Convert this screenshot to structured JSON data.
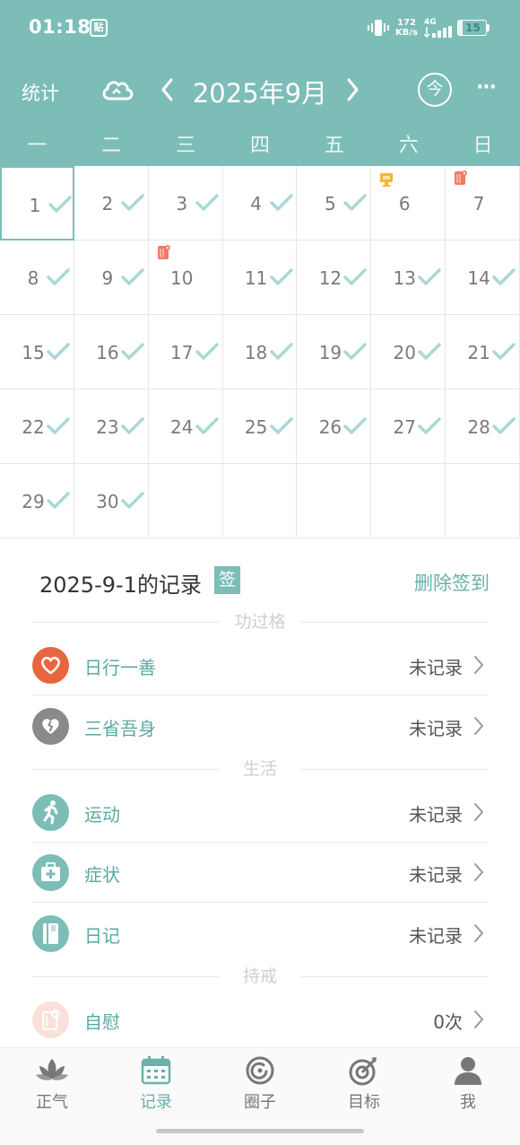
{
  "status_bar": {
    "time": "01:18",
    "badge": "贴",
    "speed_value": "172",
    "speed_unit": "KB/s",
    "network": "4G",
    "battery": "15",
    "battery_level": 0.15
  },
  "nav": {
    "stats_label": "统计",
    "month_title": "2025年9月",
    "today_label": "今",
    "more_label": "···"
  },
  "weekdays": [
    "一",
    "二",
    "三",
    "四",
    "五",
    "六",
    "日"
  ],
  "calendar": {
    "days": [
      {
        "num": "1",
        "checked": true,
        "selected": true
      },
      {
        "num": "2",
        "checked": true
      },
      {
        "num": "3",
        "checked": true
      },
      {
        "num": "4",
        "checked": true
      },
      {
        "num": "5",
        "checked": true
      },
      {
        "num": "6",
        "checked": false,
        "mark": "gift-icon"
      },
      {
        "num": "7",
        "checked": false,
        "mark": "toilet-paper-icon"
      },
      {
        "num": "8",
        "checked": true
      },
      {
        "num": "9",
        "checked": true
      },
      {
        "num": "10",
        "checked": false,
        "mark": "toilet-paper-icon"
      },
      {
        "num": "11",
        "checked": true
      },
      {
        "num": "12",
        "checked": true
      },
      {
        "num": "13",
        "checked": true
      },
      {
        "num": "14",
        "checked": true
      },
      {
        "num": "15",
        "checked": true
      },
      {
        "num": "16",
        "checked": true
      },
      {
        "num": "17",
        "checked": true
      },
      {
        "num": "18",
        "checked": true
      },
      {
        "num": "19",
        "checked": true
      },
      {
        "num": "20",
        "checked": true
      },
      {
        "num": "21",
        "checked": true
      },
      {
        "num": "22",
        "checked": true
      },
      {
        "num": "23",
        "checked": true
      },
      {
        "num": "24",
        "checked": true
      },
      {
        "num": "25",
        "checked": true
      },
      {
        "num": "26",
        "checked": true
      },
      {
        "num": "27",
        "checked": true
      },
      {
        "num": "28",
        "checked": true
      },
      {
        "num": "29",
        "checked": true
      },
      {
        "num": "30",
        "checked": true
      }
    ]
  },
  "records": {
    "title": "2025-9-1的记录",
    "sign_badge": "签",
    "delete_label": "删除签到",
    "sections": [
      {
        "title": "功过格",
        "rows": [
          {
            "label": "日行一善",
            "value": "未记录",
            "icon": "heart-icon",
            "color": "#e8663f"
          },
          {
            "label": "三省吾身",
            "value": "未记录",
            "icon": "broken-heart-icon",
            "color": "#8a8a8a"
          }
        ]
      },
      {
        "title": "生活",
        "rows": [
          {
            "label": "运动",
            "value": "未记录",
            "icon": "running-icon",
            "color": "#7dbdb7"
          },
          {
            "label": "症状",
            "value": "未记录",
            "icon": "medical-kit-icon",
            "color": "#7dbdb7"
          },
          {
            "label": "日记",
            "value": "未记录",
            "icon": "notebook-icon",
            "color": "#7dbdb7"
          }
        ]
      },
      {
        "title": "持戒",
        "rows": [
          {
            "label": "自慰",
            "value": "0次",
            "icon": "toilet-paper-icon",
            "color": "#fbe0da"
          }
        ]
      }
    ]
  },
  "bottom_nav": [
    {
      "label": "正气",
      "icon": "lotus-icon"
    },
    {
      "label": "记录",
      "icon": "calendar-icon",
      "active": true
    },
    {
      "label": "圈子",
      "icon": "circle-icon"
    },
    {
      "label": "目标",
      "icon": "target-icon"
    },
    {
      "label": "我",
      "icon": "user-icon"
    }
  ],
  "colors": {
    "primary": "#7dbdb7",
    "primary_text": "#6ab1aa",
    "check": "#a9d9d4",
    "heart": "#e8663f"
  }
}
